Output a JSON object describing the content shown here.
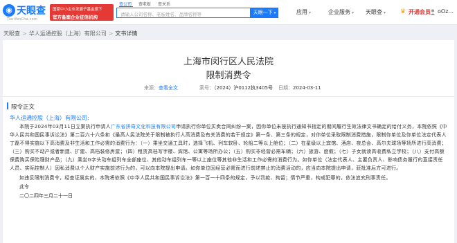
{
  "header": {
    "logo_text": "天眼查",
    "logo_sub": "TianYanCha.com",
    "ad_line1": "国家中小企业发展子基金旗下",
    "ad_line2": "官方备案企业征信机构",
    "tabs": [
      "查公司",
      "查老板",
      "查关系"
    ],
    "search_placeholder": "请输入公司名称、老板姓名、品牌名称等",
    "search_button": "天眼一下",
    "nav": [
      "应用",
      "企业服务",
      "天眼查"
    ],
    "vip_label": "开通会员",
    "user_name": "oOz..."
  },
  "breadcrumb": {
    "items": [
      "天眼查",
      "华人运通控股（上海）有限公司",
      "文书详情"
    ]
  },
  "document": {
    "court": "上海市闵行区人民法院",
    "title": "限制消费令",
    "meta": {
      "source_label": "来源：",
      "source_link": "查看全文",
      "case_no_label": "案号：",
      "case_no": "（2024）沪0112执3405号",
      "date_label": "日期：",
      "date": "2024-03-11"
    },
    "section_title": "限令正文",
    "addressee": "华人运通控股（上海）有限公司:",
    "para1_a": "本院于2024年03月11日立案执行申请人",
    "para1_link": "广东省拼奇文化科技有限公司",
    "para1_b": "申请执行你单位买卖合同纠纷一案，因你单位未按执行通知书指定的期间履行生效法律文书确定的给付义务，本院依照《中华人民共和国民事诉讼法》第二百六十六条和《最高人民法院关于限制被执行人高消费及有关消费的若干规定》第一条、第三条的规定，对你单位采取限制消费措施，限制你单位及你单位法定代表人丁磊不得实施以下高消费及非生活和工作必需的消费行为：（一）乘坐交通工具时，选择飞机、列车软卧、轮船二等以上舱位；（二）在星级以上宾馆、酒店、夜总会、高尔夫球场等场所进行高消费；（三）购买不动产或者新建、扩建、高档装修房屋；（四）租赁高档写字楼、宾馆、公寓等场所办公；（五）购买非经营必需车辆；（六）旅游、度假；（七）子女就读高收费私立学校；（八）支付高额保费购买保险理财产品；（九）乘坐G字头动车组列车全部座位、其他动车组列车一等以上座位等其他非生活和工作必需的消费行为。如你单位（法定代表人、主要负责人、影响债务履行的直接责任人员、实际控制人）因私消费以个人财产实施前述行为的，可以向本院提出申请。如你单位因经营必需而进行前述禁止的消费活动的，应当向本院提出申请，获批准后方可进行。",
    "para2": "如违反限制消费令，经查证属实的，本院将依照《中华人民共和国民事诉讼法》第一百一十四条的规定，予以罚款、拘留；情节严重，构成犯罪的，依法追究刑事责任。",
    "sign": "此令",
    "sign_date": "二〇二四年三月二十一日"
  },
  "colors": {
    "accent": "#1b7bff",
    "brand_red": "#e53935",
    "vip_gold": "#e8a317",
    "page_bg": "#eef0f5"
  }
}
